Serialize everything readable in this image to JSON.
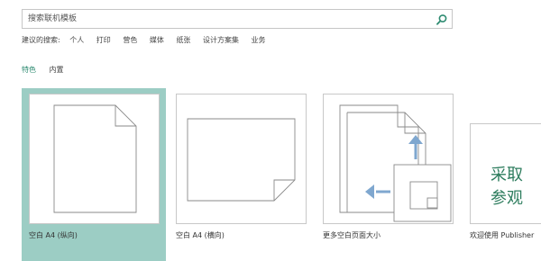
{
  "search": {
    "placeholder": "搜索联机模板",
    "value": "",
    "icon": "search-icon"
  },
  "suggested": {
    "label": "建议的搜索:",
    "items": [
      "个人",
      "打印",
      "营色",
      "媒体",
      "纸张",
      "设计方案集",
      "业务"
    ]
  },
  "tabs": [
    {
      "label": "特色",
      "active": true
    },
    {
      "label": "内置",
      "active": false
    }
  ],
  "templates": [
    {
      "label": "空白 A4 (纵向)",
      "selected": true
    },
    {
      "label": "空白 A4 (横向)",
      "selected": false
    },
    {
      "label": "更多空白页面大小",
      "selected": false
    },
    {
      "label": "欢迎使用 Publisher",
      "selected": false,
      "thumb_lines": [
        "采取",
        "参观"
      ]
    }
  ],
  "colors": {
    "accent": "#2e8b71",
    "selected_tile": "#9ccdc4",
    "arrow_blue": "#7fa7cf",
    "publisher_green": "#2e7d5e"
  }
}
